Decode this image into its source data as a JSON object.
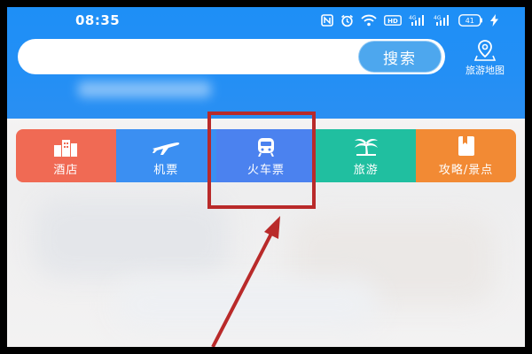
{
  "status_bar": {
    "time": "08:35",
    "icons": [
      "nfc-icon",
      "alarm-icon",
      "wifi-icon",
      "hd-icon",
      "signal-4g-icon",
      "signal-icon",
      "battery-icon",
      "charging-icon"
    ],
    "battery_level": "41"
  },
  "search": {
    "placeholder": "",
    "button_label": "搜索"
  },
  "map_entry": {
    "label": "旅游地图",
    "icon": "map-pin-icon"
  },
  "categories": [
    {
      "label": "酒店",
      "icon": "hotel-building-icon",
      "color": "#f06a54"
    },
    {
      "label": "机票",
      "icon": "airplane-icon",
      "color": "#3b8ff2"
    },
    {
      "label": "火车票",
      "icon": "train-icon",
      "color": "#4b82ef"
    },
    {
      "label": "旅游",
      "icon": "palm-tree-icon",
      "color": "#20bfa0"
    },
    {
      "label": "攻略/景点",
      "icon": "guidebook-icon",
      "color": "#f28a34"
    }
  ],
  "annotation": {
    "highlight_color": "#b92a2a",
    "highlighted_item": "火车票"
  }
}
